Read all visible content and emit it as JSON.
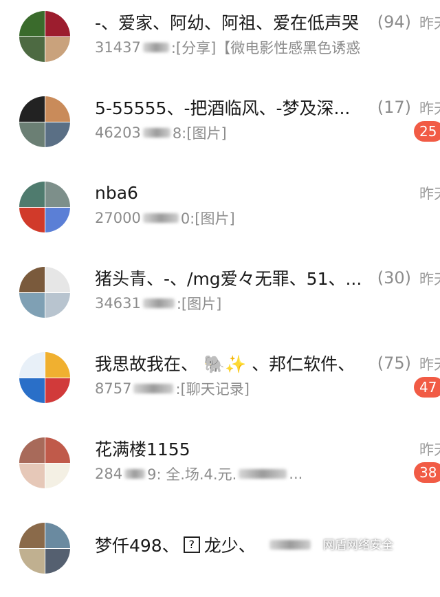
{
  "chats": [
    {
      "name": "-、爱家、阿幼、阿祖、爱在低声哭",
      "count": "(94)",
      "preview_prefix": "31437",
      "preview_suffix": ":[分享]【微电影性感黑色诱惑",
      "time": "昨天",
      "badge": "",
      "avatar_colors": [
        "#3a6b2c",
        "#9c1d2e",
        "#4d6a42",
        "#c9a27c"
      ]
    },
    {
      "name": "5-55555、-把酒临风、-梦及深...",
      "count": "(17)",
      "preview_prefix": "46203",
      "preview_suffix": "8:[图片]",
      "time": "昨天",
      "badge": "25",
      "avatar_colors": [
        "#222222",
        "#c98b5a",
        "#6b7f74",
        "#5a6f85"
      ]
    },
    {
      "name": "nba6",
      "count": "",
      "preview_prefix": "27000",
      "preview_suffix": "0:[图片]",
      "time": "昨天",
      "badge": "",
      "avatar_colors": [
        "#4f7b6e",
        "#7d8f8a",
        "#d13a2a",
        "#5b7fd6"
      ]
    },
    {
      "name": "猪头青、-、/mg爱々无罪、51、...",
      "count": "(30)",
      "preview_prefix": "34631",
      "preview_suffix": ":[图片]",
      "time": "昨天",
      "badge": "",
      "avatar_colors": [
        "#7a5a3c",
        "#e6e6e6",
        "#7fa0b4",
        "#b8c4cf"
      ]
    },
    {
      "name": "我思故我在、 🐘✨ 、邦仁软件、",
      "count": "(75)",
      "preview_prefix": "8757",
      "preview_suffix": ":[聊天记录]",
      "time": "昨天",
      "badge": "47",
      "avatar_colors": [
        "#e8f0f8",
        "#f0b030",
        "#2a6fc8",
        "#d13a3a"
      ]
    },
    {
      "name": "花满楼1155",
      "count": "",
      "preview_prefix": "284",
      "preview_suffix": "9: 全.场.4.元.",
      "preview_tail": "...",
      "time": "昨天",
      "badge": "38",
      "avatar_colors": [
        "#a86a5a",
        "#c05a4a",
        "#e6c8b8",
        "#f4f0e4"
      ]
    },
    {
      "name": "梦仟498、",
      "name_mid": "?",
      "name_tail": "龙少、",
      "count": "",
      "preview_prefix": "",
      "preview_suffix": "",
      "time": "",
      "badge": "",
      "avatar_colors": [
        "#8a6a4a",
        "#6a8aa0",
        "#c0b090",
        "#556070"
      ]
    }
  ],
  "watermark": "网盾网络安全"
}
